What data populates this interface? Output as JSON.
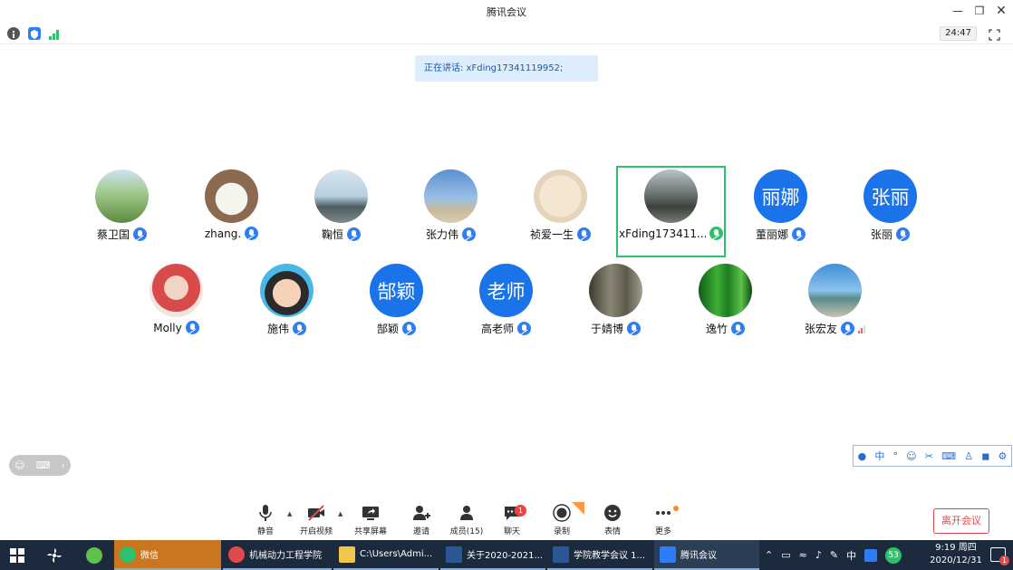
{
  "window": {
    "title": "腾讯会议"
  },
  "top_toolbar": {
    "timer": "24:47"
  },
  "speaking": {
    "label": "正在讲话: xFding17341119952;"
  },
  "participants": [
    {
      "name": "蔡卫国",
      "avatar_text": "",
      "mic": "on"
    },
    {
      "name": "zhang.",
      "avatar_text": "",
      "mic": "on"
    },
    {
      "name": "鞠恒",
      "avatar_text": "",
      "mic": "on"
    },
    {
      "name": "张力伟",
      "avatar_text": "",
      "mic": "on"
    },
    {
      "name": "祯爱一生",
      "avatar_text": "",
      "mic": "on"
    },
    {
      "name": "xFding173411...",
      "avatar_text": "",
      "mic": "speaking"
    },
    {
      "name": "董丽娜",
      "avatar_text": "丽娜",
      "mic": "on"
    },
    {
      "name": "张丽",
      "avatar_text": "张丽",
      "mic": "on"
    },
    {
      "name": "Molly",
      "avatar_text": "",
      "mic": "on"
    },
    {
      "name": "施伟",
      "avatar_text": "",
      "mic": "on"
    },
    {
      "name": "郜颖",
      "avatar_text": "郜颖",
      "mic": "on"
    },
    {
      "name": "高老师",
      "avatar_text": "老师",
      "mic": "on"
    },
    {
      "name": "于婧博",
      "avatar_text": "",
      "mic": "on"
    },
    {
      "name": "逸竹",
      "avatar_text": "",
      "mic": "on"
    },
    {
      "name": "张宏友",
      "avatar_text": "",
      "mic": "on"
    }
  ],
  "ime": {
    "lang": "中"
  },
  "bottom_bar": {
    "mute": "静音",
    "video": "开启视频",
    "share": "共享屏幕",
    "invite": "邀请",
    "members": "成员(15)",
    "chat": "聊天",
    "chat_badge": "1",
    "record": "录制",
    "reactions": "表情",
    "more": "更多",
    "leave": "离开会议"
  },
  "taskbar": {
    "items": [
      "微信",
      "机械动力工程学院",
      "C:\\Users\\Admi...",
      "关于2020-2021...",
      "学院教学会议 1...",
      "腾讯会议"
    ],
    "tray_lang": "中",
    "tray_badge": "53",
    "time": "9:19 周四",
    "date": "2020/12/31",
    "notif_count": "1"
  },
  "colors": {
    "accent": "#2d7df6",
    "speaking_border": "#2ec16b",
    "leave": "#e04a4a",
    "taskbar": "#1b2a3c"
  }
}
